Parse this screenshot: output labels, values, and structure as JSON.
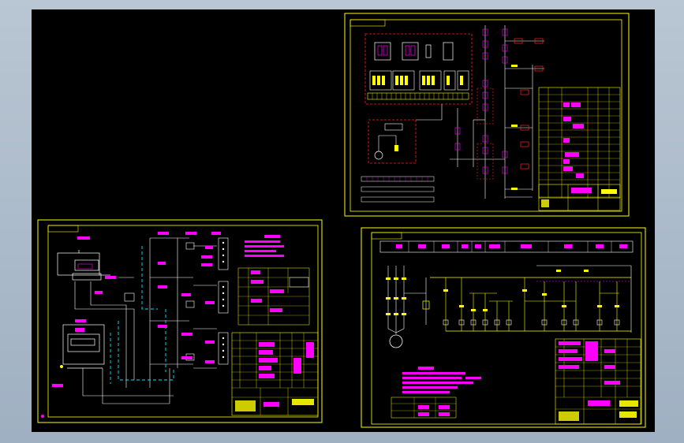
{
  "colors": {
    "background": "#000000",
    "frame": "#ffff00",
    "wire": "#ffffff",
    "dashed_box": "#ff2020",
    "annotation": "#ff00ff",
    "cyan": "#00e5ff",
    "viewport_surround": "#a9b7c6"
  },
  "sheets": [
    {
      "id": "top-right",
      "type": "control-circuit-schematic"
    },
    {
      "id": "bottom-left",
      "type": "wiring-diagram"
    },
    {
      "id": "bottom-right",
      "type": "main-circuit-schematic"
    }
  ]
}
